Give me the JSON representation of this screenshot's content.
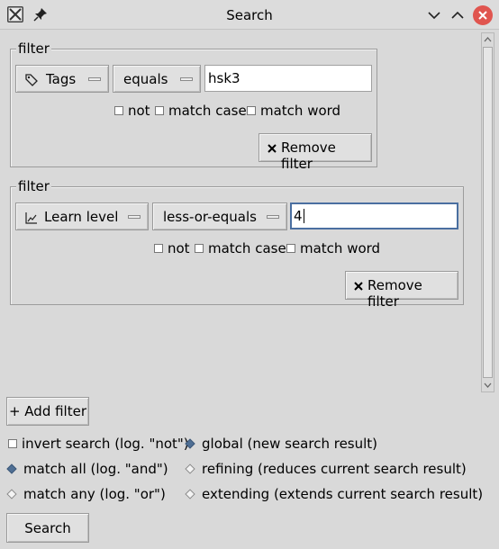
{
  "window": {
    "title": "Search",
    "controls": {
      "minimize_icon": "chevron-down-icon",
      "maximize_icon": "chevron-up-icon",
      "close_icon": "close-icon",
      "close_color": "#e0554f"
    }
  },
  "filters": [
    {
      "legend": "filter",
      "field": {
        "icon": "tag-icon",
        "label": "Tags"
      },
      "operator": "equals",
      "value": "hsk3",
      "not_label": "not",
      "match_case_label": "match case",
      "match_word_label": "match word",
      "remove_label": "Remove filter"
    },
    {
      "legend": "filter",
      "field": {
        "icon": "chart-line-icon",
        "label": "Learn level"
      },
      "operator": "less-or-equals",
      "value": "4",
      "not_label": "not",
      "match_case_label": "match case",
      "match_word_label": "match word",
      "remove_label": "Remove filter"
    }
  ],
  "add_filter_label": "+ Add filter",
  "invert_label": "invert search (log. \"not\")",
  "match_mode": {
    "selected": "all",
    "all_label": "match all (log. \"and\")",
    "any_label": "match any (log. \"or\")"
  },
  "scope": {
    "selected": "global",
    "global_label": "global (new search result)",
    "refining_label": "refining (reduces current search result)",
    "extending_label": "extending (extends current search result)"
  },
  "search_button_label": "Search",
  "colors": {
    "background": "#d9d9d9",
    "radio_selected": "#4f6f94",
    "focus_border": "#4a6fa0"
  }
}
